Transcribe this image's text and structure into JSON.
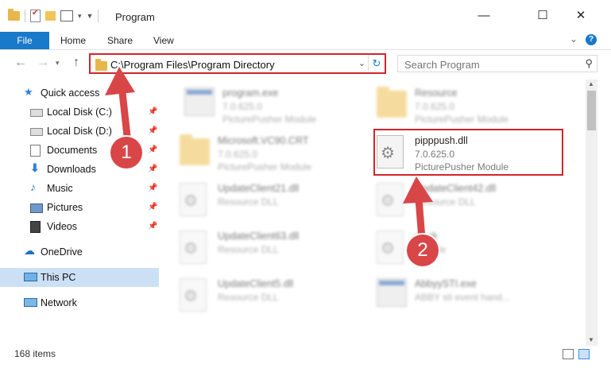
{
  "window": {
    "title": "Program",
    "controls": {
      "minimize": "—",
      "maximize": "☐",
      "close": "✕"
    }
  },
  "ribbon": {
    "file_tab": "File",
    "tabs": [
      "Home",
      "Share",
      "View"
    ],
    "help": "?"
  },
  "navigation": {
    "address": "C:\\Program Files\\Program Directory",
    "search_placeholder": "Search Program"
  },
  "sidebar": {
    "items": [
      {
        "label": "Quick access",
        "icon": "star-icon",
        "pinned": false
      },
      {
        "label": "Local Disk (C:)",
        "icon": "drive-icon",
        "pinned": true
      },
      {
        "label": "Local Disk (D:)",
        "icon": "drive-icon",
        "pinned": true
      },
      {
        "label": "Documents",
        "icon": "documents-icon",
        "pinned": true
      },
      {
        "label": "Downloads",
        "icon": "download-icon",
        "pinned": true
      },
      {
        "label": "Music",
        "icon": "music-icon",
        "pinned": true
      },
      {
        "label": "Pictures",
        "icon": "pictures-icon",
        "pinned": true
      },
      {
        "label": "Videos",
        "icon": "videos-icon",
        "pinned": true
      },
      {
        "label": "OneDrive",
        "icon": "cloud-icon",
        "pinned": false
      },
      {
        "label": "This PC",
        "icon": "computer-icon",
        "pinned": false,
        "selected": true
      },
      {
        "label": "Network",
        "icon": "network-icon",
        "pinned": false
      }
    ]
  },
  "files": [
    {
      "name": "program.exe",
      "line1": "7.0.625.0",
      "line2": "PicturePusher Module",
      "icon": "exe-icon",
      "blurred": true
    },
    {
      "name": "Resource",
      "line1": "7.0.625.0",
      "line2": "PicturePusher Module",
      "icon": "folder-icon",
      "blurred": true
    },
    {
      "name": "Microsoft.VC90.CRT",
      "line1": "7.0.625.0",
      "line2": "PicturePusher Module",
      "icon": "folder-icon",
      "blurred": true
    },
    {
      "name": "pipppush.dll",
      "line1": "7.0.625.0",
      "line2": "PicturePusher Module",
      "icon": "dll-icon",
      "blurred": false
    },
    {
      "name": "UpdateClient21.dll",
      "line1": "Resource DLL",
      "line2": "",
      "icon": "dll-icon",
      "blurred": true
    },
    {
      "name": "UpdateClient42.dll",
      "line1": "Resource DLL",
      "line2": "",
      "icon": "dll-icon",
      "blurred": true
    },
    {
      "name": "UpdateClient63.dll",
      "line1": "Resource DLL",
      "line2": "",
      "icon": "dll-icon",
      "blurred": true
    },
    {
      "name": "dll.ck",
      "line1": "CK File",
      "line2": "",
      "icon": "file-icon",
      "blurred": true
    },
    {
      "name": "UpdateClient5.dll",
      "line1": "Resource DLL",
      "line2": "",
      "icon": "dll-icon",
      "blurred": true
    },
    {
      "name": "AbbyySTI.exe",
      "line1": "ABBY sti event hand...",
      "line2": "",
      "icon": "exe-icon",
      "blurred": true
    }
  ],
  "status": {
    "item_count": "168 items"
  },
  "annotations": {
    "badge1": "1",
    "badge2": "2",
    "accent_color": "#d94648"
  }
}
